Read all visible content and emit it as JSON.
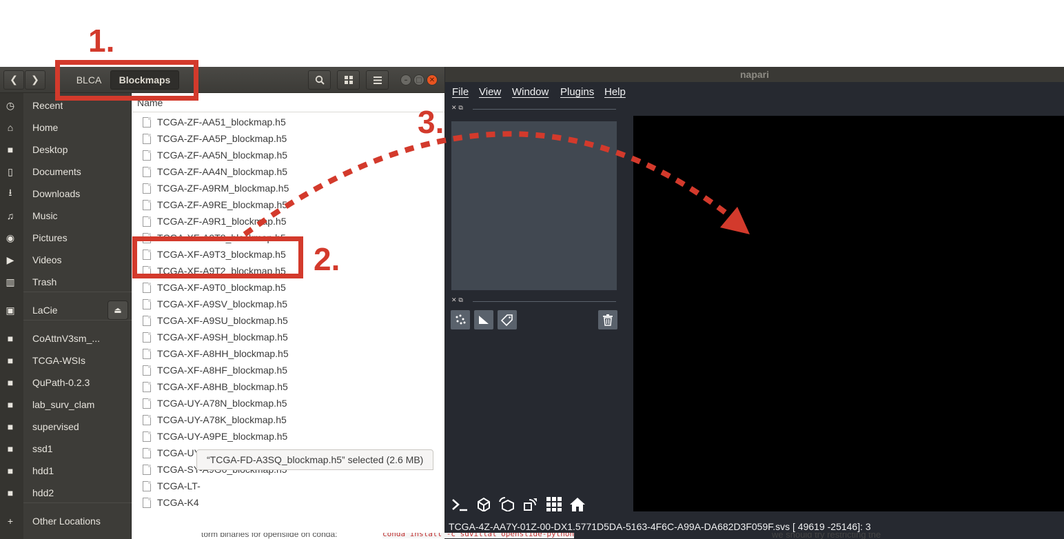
{
  "annotations": {
    "step1": "1.",
    "step2": "2.",
    "step3": "3.",
    "color": "#d33a2c"
  },
  "files": {
    "breadcrumbs": [
      "BLCA",
      "Blockmaps"
    ],
    "column_header": "Name",
    "sidebar": [
      {
        "label": "Recent",
        "icon": "clock-icon"
      },
      {
        "label": "Home",
        "icon": "home-icon"
      },
      {
        "label": "Desktop",
        "icon": "folder-icon"
      },
      {
        "label": "Documents",
        "icon": "document-icon"
      },
      {
        "label": "Downloads",
        "icon": "download-icon"
      },
      {
        "label": "Music",
        "icon": "music-icon"
      },
      {
        "label": "Pictures",
        "icon": "camera-icon"
      },
      {
        "label": "Videos",
        "icon": "video-icon"
      },
      {
        "label": "Trash",
        "icon": "trash-icon"
      },
      {
        "label": "LaCie",
        "icon": "drive-icon"
      },
      {
        "label": "CoAttnV3sm_...",
        "icon": "folder-icon"
      },
      {
        "label": "TCGA-WSIs",
        "icon": "folder-icon"
      },
      {
        "label": "QuPath-0.2.3",
        "icon": "folder-icon"
      },
      {
        "label": "lab_surv_clam",
        "icon": "folder-icon"
      },
      {
        "label": "supervised",
        "icon": "folder-icon"
      },
      {
        "label": "ssd1",
        "icon": "folder-icon"
      },
      {
        "label": "hdd1",
        "icon": "folder-icon"
      },
      {
        "label": "hdd2",
        "icon": "folder-icon"
      },
      {
        "label": "Other Locations",
        "icon": "plus-icon"
      }
    ],
    "rows": [
      "TCGA-ZF-AA51_blockmap.h5",
      "TCGA-ZF-AA5P_blockmap.h5",
      "TCGA-ZF-AA5N_blockmap.h5",
      "TCGA-ZF-AA4N_blockmap.h5",
      "TCGA-ZF-A9RM_blockmap.h5",
      "TCGA-ZF-A9RE_blockmap.h5",
      "TCGA-ZF-A9R1_blockmap.h5",
      "TCGA-XF-A9T8_blockmap.h5",
      "TCGA-XF-A9T3_blockmap.h5",
      "TCGA-XF-A9T2_blockmap.h5",
      "TCGA-XF-A9T0_blockmap.h5",
      "TCGA-XF-A9SV_blockmap.h5",
      "TCGA-XF-A9SU_blockmap.h5",
      "TCGA-XF-A9SH_blockmap.h5",
      "TCGA-XF-A8HH_blockmap.h5",
      "TCGA-XF-A8HF_blockmap.h5",
      "TCGA-XF-A8HB_blockmap.h5",
      "TCGA-UY-A78N_blockmap.h5",
      "TCGA-UY-A78K_blockmap.h5",
      "TCGA-UY-A9PE_blockmap.h5",
      "TCGA-UY-A9PB_blockmap.h5",
      "TCGA-SY-A9G0_blockmap.h5",
      "TCGA-LT-",
      "TCGA-K4"
    ],
    "status": "“TCGA-FD-A3SQ_blockmap.h5” selected  (2.6 MB)"
  },
  "napari": {
    "title": "napari",
    "menu": [
      "File",
      "View",
      "Window",
      "Plugins",
      "Help"
    ],
    "status": "TCGA-4Z-AA7Y-01Z-00-DX1.5771D5DA-5163-4F6C-A99A-DA682D3F059F.svs [ 49619 -25146]: 3"
  },
  "background_text": {
    "left": "torm binaries for openslide on conda:",
    "code": "conda install -c sdvillal openslide-python",
    "right": "we should try restricting the"
  }
}
